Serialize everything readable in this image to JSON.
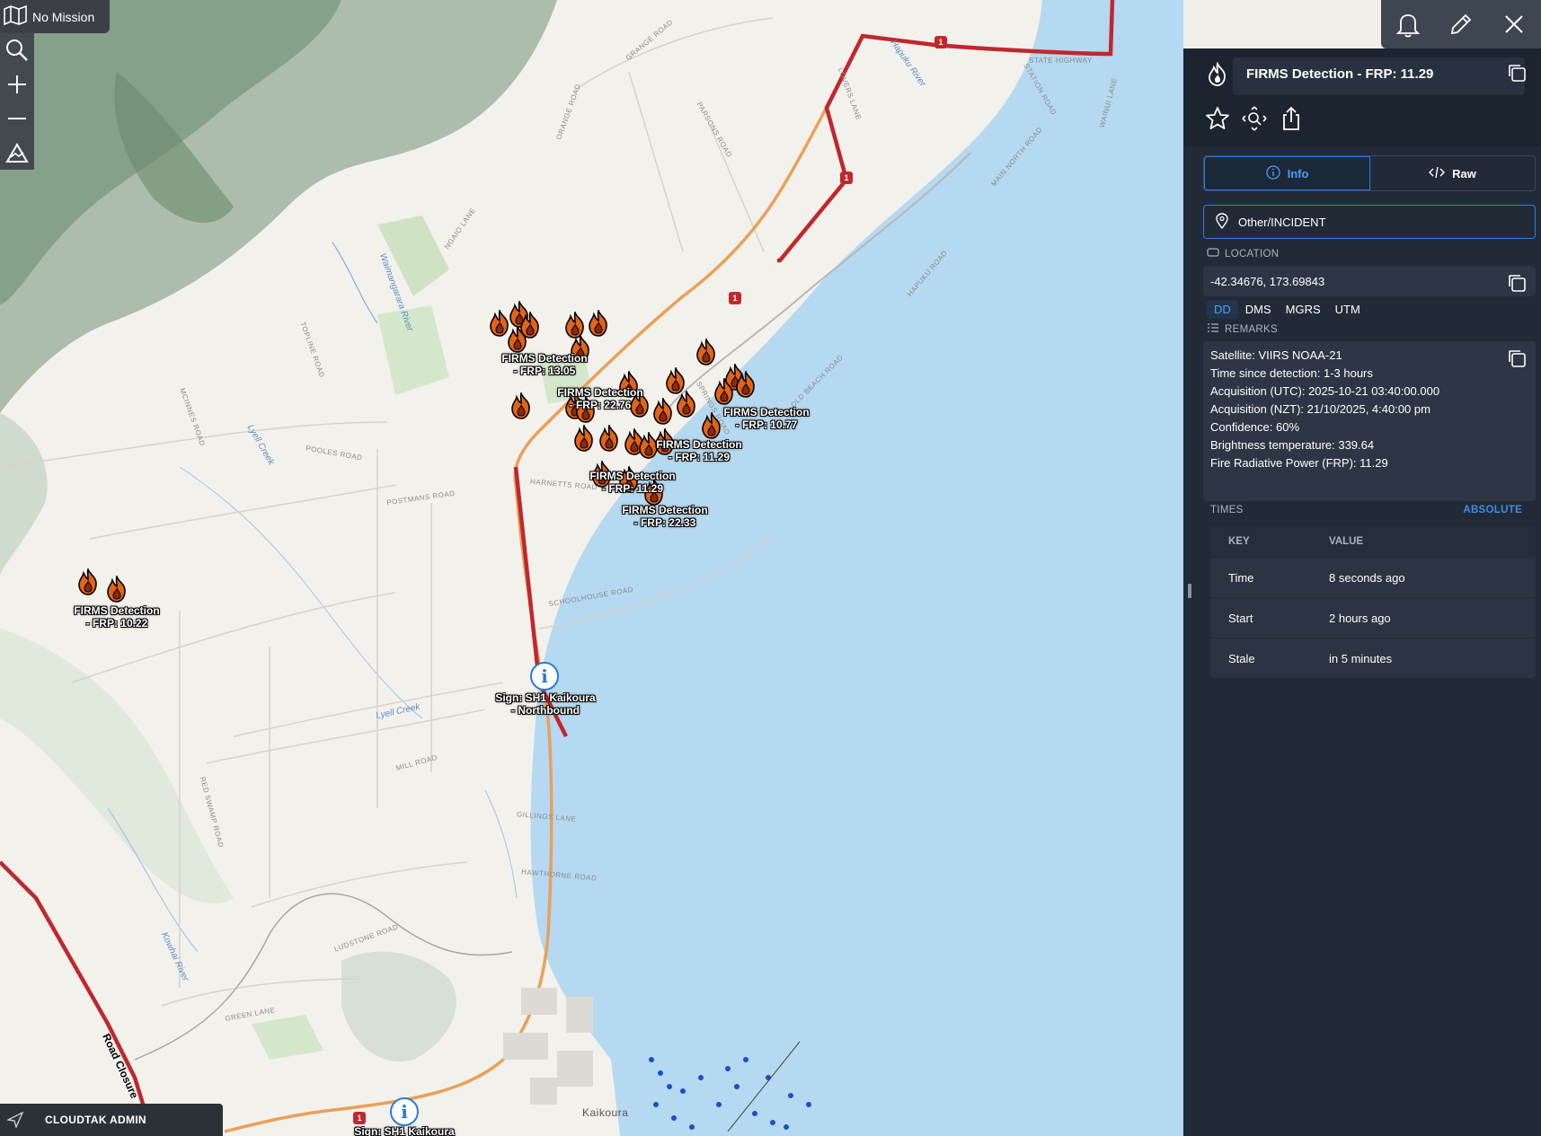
{
  "mission": {
    "label": "No Mission"
  },
  "user": {
    "name": "CLOUDTAK ADMIN"
  },
  "map": {
    "roads": [
      "ORANGE ROAD",
      "GRANGE ROAD",
      "PARSONS ROAD",
      "TOPLINE ROAD",
      "POOLES ROAD",
      "POSTMANS ROAD",
      "HARNETTS ROAD",
      "SCHOOLHOUSE ROAD",
      "MILL ROAD",
      "RED SWAMP ROAD",
      "GILLINGS LANE",
      "HAWTHORNE ROAD",
      "LUDSTONE ROAD",
      "GREEN LANE",
      "STATE HIGHWAY",
      "OLD BEACH ROAD",
      "MAIN NORTH ROAD",
      "STATION ROAD",
      "MCINNES ROAD",
      "SPRINGS ROAD",
      "NGAIO LANE",
      "LOVERS LANE",
      "HAPUKU ROAD",
      "WAINUI LANE"
    ],
    "water": [
      "Lyell Creek",
      "Waimangarara River",
      "Kowhai River",
      "Hapuku River",
      "Lyell Creek"
    ],
    "town": "Kaikoura",
    "road_closure": "Road Closure",
    "fire_labels": [
      {
        "text": "FIRMS Detection\n- FRP: 13.05"
      },
      {
        "text": "FIRMS Detection\n- FRP: 22.76"
      },
      {
        "text": "FIRMS Detection\n- FRP: 10.77"
      },
      {
        "text": "FIRMS Detection\n- FRP: 11.29"
      },
      {
        "text": "FIRMS Detection\n- FRP: 11.29"
      },
      {
        "text": "FIRMS Detection\n- FRP: 22.33"
      },
      {
        "text": "FIRMS Detection\n- FRP: 10.22"
      }
    ],
    "signs": [
      {
        "text": "Sign: SH1 Kaikoura\n- Northbound"
      },
      {
        "text": "Sign: SH1 Kaikoura"
      }
    ]
  },
  "panel": {
    "title": "FIRMS Detection - FRP: 11.29",
    "tabs": [
      {
        "label": "Info",
        "icon": "info-icon"
      },
      {
        "label": "Raw",
        "icon": "code-icon"
      }
    ],
    "type": "Other/INCIDENT",
    "location_label": "LOCATION",
    "location_value": "-42.34676, 173.69843",
    "coord_modes": [
      "DD",
      "DMS",
      "MGRS",
      "UTM"
    ],
    "remarks_label": "REMARKS",
    "remarks": [
      "Satellite: VIIRS NOAA-21",
      "Time since detection: 1-3 hours",
      "Acquisition (UTC): 2025-10-21 03:40:00.000",
      "Acquisition (NZT): 21/10/2025, 4:40:00 pm",
      "Confidence: 60%",
      "Brightness temperature: 339.64",
      "Fire Radiative Power (FRP): 11.29"
    ],
    "times_label": "TIMES",
    "absolute_label": "ABSOLUTE",
    "times_header": {
      "key": "KEY",
      "value": "VALUE"
    },
    "times": [
      {
        "key": "Time",
        "value": "8 seconds ago"
      },
      {
        "key": "Start",
        "value": "2 hours ago"
      },
      {
        "key": "Stale",
        "value": "in 5 minutes"
      }
    ]
  },
  "colors": {
    "accent": "#2c7be5",
    "panel_bg": "#212a36",
    "highway": "#c1272d",
    "road": "#e9a15a",
    "sea": "#b5d9f0"
  }
}
